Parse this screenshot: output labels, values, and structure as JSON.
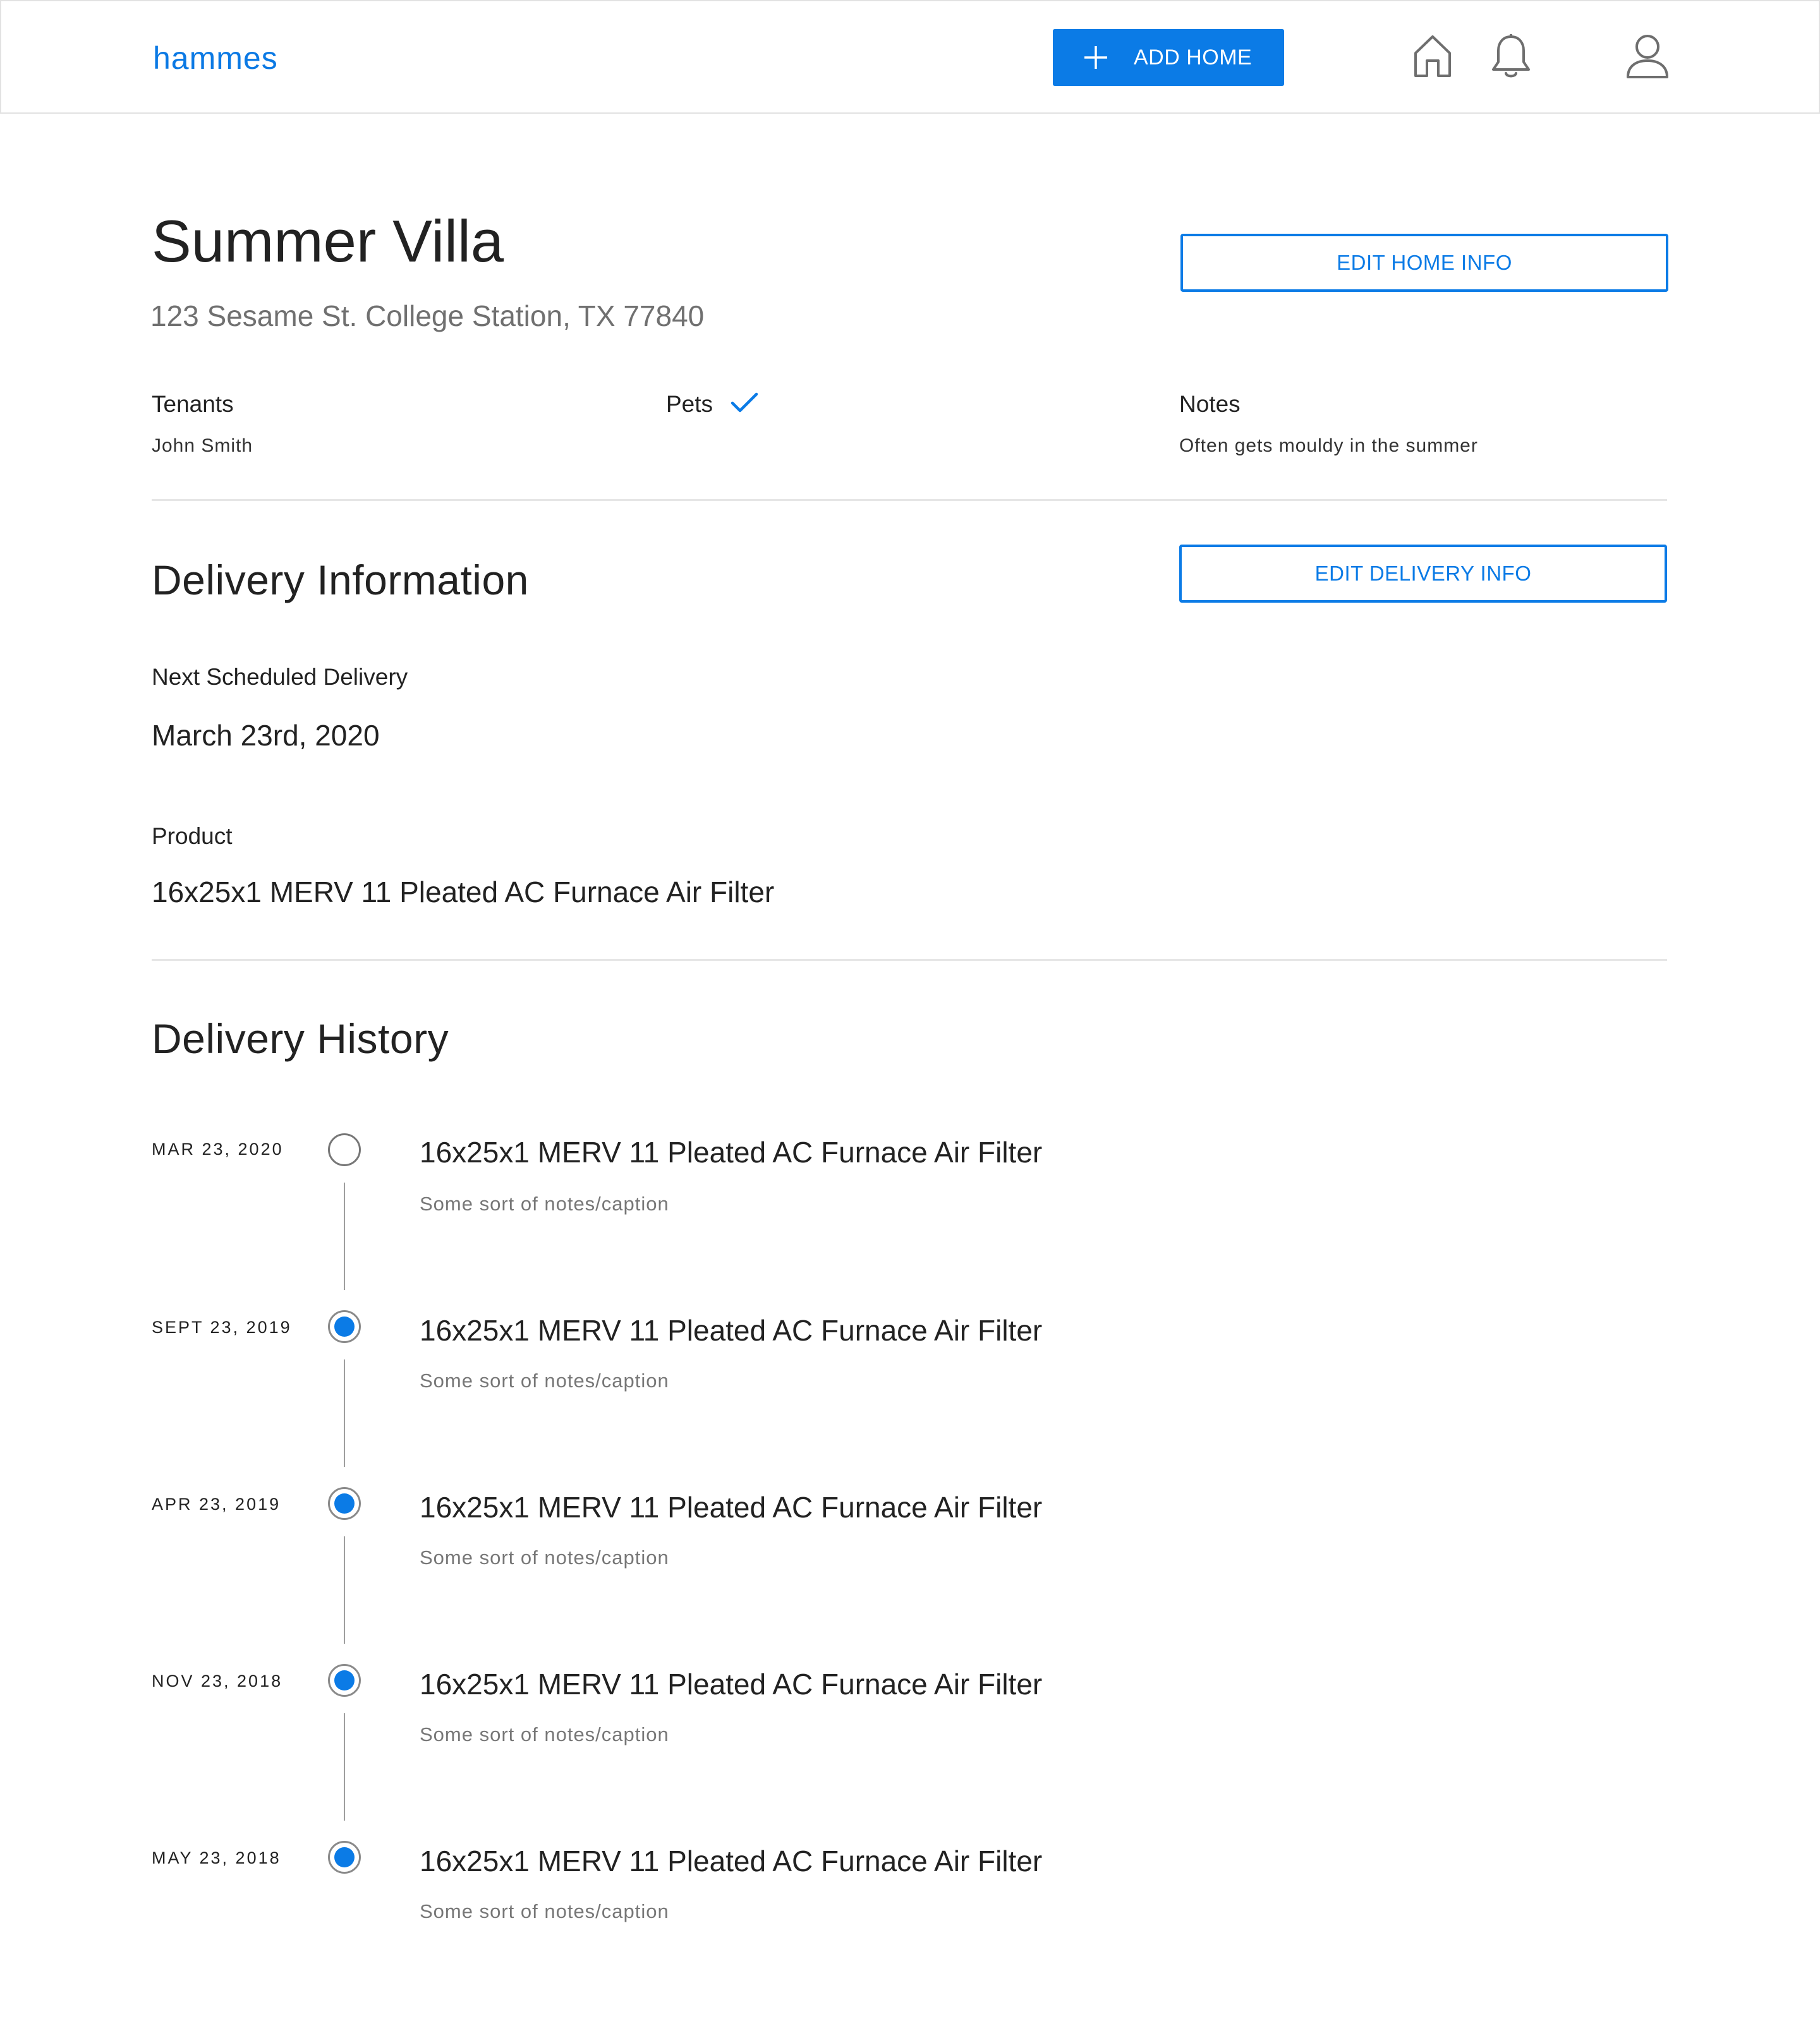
{
  "header": {
    "brand": "hammes",
    "add_home_label": "ADD HOME",
    "icons": [
      "home-icon",
      "bell-icon",
      "user-icon"
    ]
  },
  "home": {
    "name": "Summer Villa",
    "address": "123 Sesame St. College Station, TX 77840",
    "edit_label": "EDIT HOME INFO",
    "tenants_label": "Tenants",
    "tenants_value": "John Smith",
    "pets_label": "Pets",
    "pets_checked": true,
    "notes_label": "Notes",
    "notes_value": "Often gets mouldy in the summer"
  },
  "delivery": {
    "title": "Delivery Information",
    "edit_label": "EDIT DELIVERY INFO",
    "next_label": "Next Scheduled Delivery",
    "next_value": "March 23rd, 2020",
    "product_label": "Product",
    "product_value": "16x25x1 MERV 11 Pleated AC Furnace Air Filter"
  },
  "history": {
    "title": "Delivery History",
    "items": [
      {
        "date": "MAR 23, 2020",
        "title": "16x25x1 MERV 11 Pleated AC Furnace Air Filter",
        "note": "Some sort of notes/caption",
        "status": "upcoming"
      },
      {
        "date": "SEPT 23, 2019",
        "title": "16x25x1 MERV 11 Pleated AC Furnace Air Filter",
        "note": "Some sort of notes/caption",
        "status": "delivered"
      },
      {
        "date": "APR 23, 2019",
        "title": "16x25x1 MERV 11 Pleated AC Furnace Air Filter",
        "note": "Some sort of notes/caption",
        "status": "delivered"
      },
      {
        "date": "NOV 23, 2018",
        "title": "16x25x1 MERV 11 Pleated AC Furnace Air Filter",
        "note": "Some sort of notes/caption",
        "status": "delivered"
      },
      {
        "date": "MAY 23, 2018",
        "title": "16x25x1 MERV 11 Pleated AC Furnace Air Filter",
        "note": "Some sort of notes/caption",
        "status": "delivered"
      }
    ]
  },
  "colors": {
    "accent": "#0b7be6",
    "text": "#212121",
    "muted": "#707070",
    "divider": "#e6e6e6"
  }
}
